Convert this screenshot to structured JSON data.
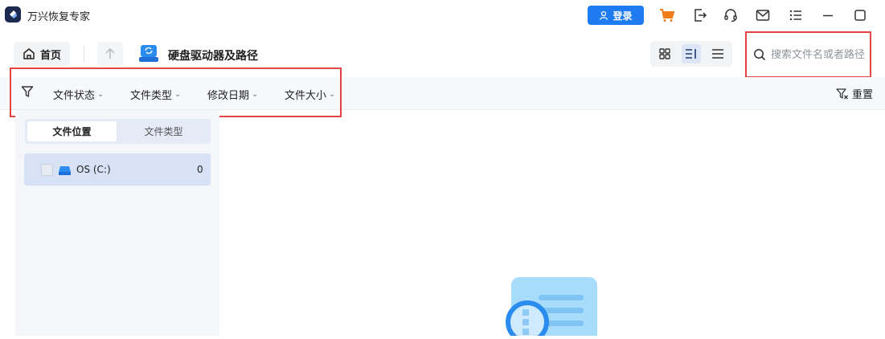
{
  "app": {
    "title": "万兴恢复专家",
    "login_label": "登录"
  },
  "titlebar_icons": [
    "cart-icon",
    "export-icon",
    "headset-icon",
    "mail-icon",
    "menu-icon",
    "minimize-icon",
    "maximize-icon"
  ],
  "nav": {
    "home_label": "首页",
    "breadcrumb_title": "硬盘驱动器及路径"
  },
  "search": {
    "placeholder": "搜索文件名或者路径"
  },
  "filters": [
    {
      "label": "文件状态"
    },
    {
      "label": "文件类型"
    },
    {
      "label": "修改日期"
    },
    {
      "label": "文件大小"
    }
  ],
  "reset_label": "重置",
  "sidebar": {
    "tabs": [
      {
        "label": "文件位置",
        "active": true
      },
      {
        "label": "文件类型",
        "active": false
      }
    ],
    "drives": [
      {
        "label": "OS (C:)",
        "count": "0"
      }
    ]
  },
  "colors": {
    "accent": "#1e7bf2",
    "cart": "#f07d1a",
    "highlight": "#e24545",
    "sidebar_bg": "#f4f6f9"
  }
}
